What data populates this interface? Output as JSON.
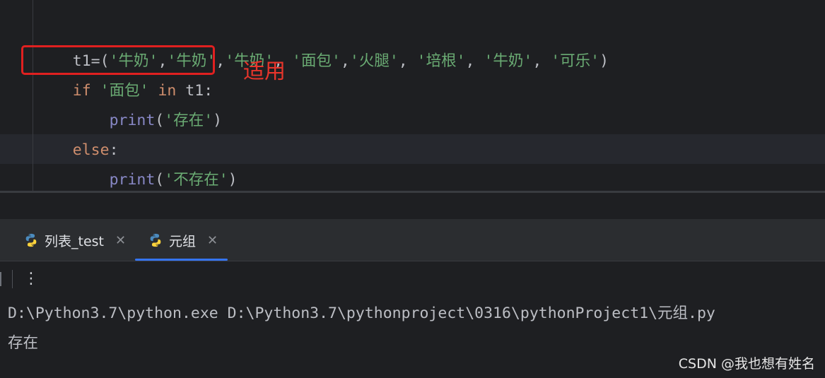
{
  "editor": {
    "line1": {
      "var": "t1",
      "eq_open": "=(",
      "items": [
        "'牛奶'",
        ",",
        "'牛奶'",
        ",",
        "'牛奶'",
        ", ",
        "'面包'",
        ",",
        "'火腿'",
        ", ",
        "'培根'",
        ", ",
        "'牛奶'",
        ", ",
        "'可乐'"
      ],
      "close": ")"
    },
    "line2": {
      "kw_if": "if",
      "sp1": " ",
      "str": "'面包'",
      "sp2": " ",
      "kw_in": "in",
      "rest": " t1:"
    },
    "line3": {
      "indent": "    ",
      "fn": "print",
      "open": "(",
      "str": "'存在'",
      "close": ")"
    },
    "line4": {
      "kw_else": "else",
      "colon": ":"
    },
    "line5": {
      "indent": "    ",
      "fn": "print",
      "open": "(",
      "str": "'不存在'",
      "close": ")"
    }
  },
  "annotation": {
    "text": "适用",
    "color": "#e8352b"
  },
  "tabs": [
    {
      "label": "列表_test",
      "close": "✕",
      "active": false
    },
    {
      "label": "元组",
      "close": "✕",
      "active": true
    }
  ],
  "toolbar": {
    "more_label": "⋮"
  },
  "console": {
    "command": "D:\\Python3.7\\python.exe D:\\Python3.7\\pythonproject\\0316\\pythonProject1\\元组.py",
    "output": "存在"
  },
  "watermark": "CSDN @我也想有姓名",
  "colors": {
    "keyword": "#cf8e6d",
    "string": "#6aab73",
    "builtin": "#8888c6",
    "accent": "#3574f0"
  }
}
